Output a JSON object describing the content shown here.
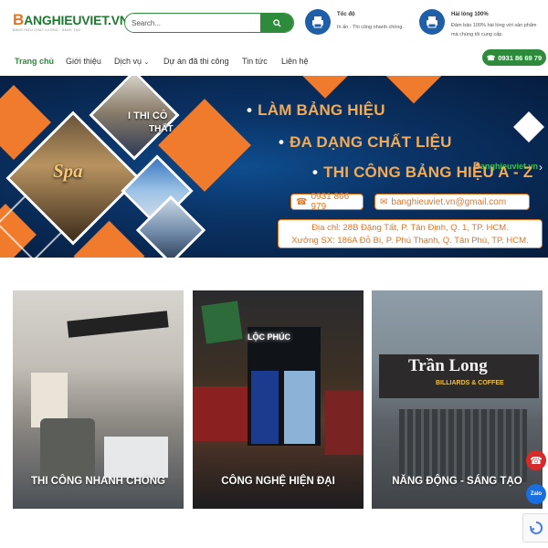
{
  "header": {
    "logo": {
      "text_b": "B",
      "text_rest": "ANGHIEUVIET.VN",
      "tagline": "BẢNG HIỆU CHẤT LƯỢNG - SÁNG TẠO"
    },
    "search": {
      "placeholder": "Search..."
    },
    "features": [
      {
        "title": "Tốc độ",
        "desc": "In ấn - Thi công nhanh chóng.",
        "icon": "printer-icon"
      },
      {
        "title": "Hài lòng 100%",
        "desc": "Đảm bảo 100% hài lòng với sản phẩm mà chúng tôi cung cấp.",
        "icon": "printer-icon"
      }
    ]
  },
  "nav": {
    "items": [
      {
        "label": "Trang chủ",
        "active": true
      },
      {
        "label": "Giới thiệu"
      },
      {
        "label": "Dịch vụ",
        "dropdown": true
      },
      {
        "label": "Dự án đã thi công"
      },
      {
        "label": "Tin tức"
      },
      {
        "label": "Liên hệ"
      }
    ],
    "phone": "0931 86 69 79"
  },
  "banner": {
    "logo_b": "B",
    "logo_rest": "anghieuviet.vn",
    "lines": [
      "LÀM BẢNG HIỆU",
      "ĐA DẠNG CHẤT LIỆU",
      "THI CÔNG BẢNG HIỆU A - Z"
    ],
    "phone": "0931 866 979",
    "email": "banghieuviet.vn@gmail.com",
    "address1": "Địa chỉ: 28B Đặng Tất, P. Tân Định, Q. 1, TP. HCM.",
    "address2": "Xưởng SX: 186A Đỗ Bí, P. Phú Thạnh, Q. Tân Phú, TP. HCM.",
    "photo_text_1": "I THI CÔ",
    "photo_text_2": "THẤT",
    "photo_text_3": "Spa"
  },
  "cards": [
    {
      "caption": "THI CÔNG NHANH CHÓNG"
    },
    {
      "caption": "CÔNG NGHỆ HIỆN ĐẠI",
      "sign": "LỘC PHÚC"
    },
    {
      "caption": "NĂNG ĐỘNG - SÁNG TẠO",
      "sign": "Trần Long",
      "sign_sub": "BILLIARDS & COFFEE"
    }
  ],
  "colors": {
    "brand_green": "#2e8b3c",
    "accent_orange": "#f07b2c",
    "banner_blue": "#0a3366"
  }
}
